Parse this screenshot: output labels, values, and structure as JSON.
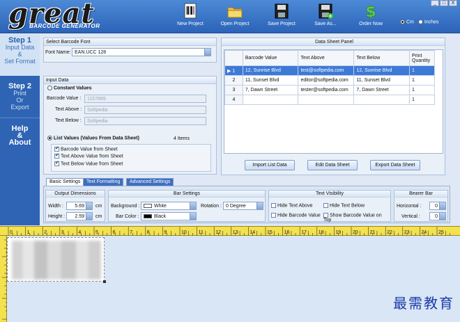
{
  "logo": {
    "title": "great",
    "subtitle": "BARCODE GENERATOR"
  },
  "toolbar": [
    {
      "id": "new",
      "label": "New  Project",
      "icon": "barcode-page-icon"
    },
    {
      "id": "open",
      "label": "Open  Project",
      "icon": "folder-icon"
    },
    {
      "id": "save",
      "label": "Save Project",
      "icon": "floppy-icon"
    },
    {
      "id": "saveas",
      "label": "Save As...",
      "icon": "floppy-add-icon"
    },
    {
      "id": "order",
      "label": "Order Now",
      "icon": "dollar-icon"
    }
  ],
  "window_controls": [
    "_",
    "□",
    "X"
  ],
  "units": {
    "cm": "Cm",
    "inches": "Inches",
    "selected": "cm"
  },
  "steps": [
    {
      "head": "Step 1",
      "lines": [
        "Input Data",
        "&",
        "Set Format"
      ],
      "active": true
    },
    {
      "head": "Step 2",
      "lines": [
        "Print",
        "Or",
        "Export"
      ],
      "active": false
    },
    {
      "head": "Help",
      "lines": [
        "&",
        "About"
      ],
      "active": false
    }
  ],
  "font_panel": {
    "title": "Select Barcode Font",
    "label": "Font Name:",
    "value": "EAN.UCC 128"
  },
  "input_panel": {
    "title": "Input Data",
    "constant_label": "Constant Values",
    "barcode_label": "Barcode Value :",
    "barcode_value": "1157869",
    "above_label": "Text Above :",
    "above_value": "Softpedia",
    "below_label": "Text Below :",
    "below_value": "Softpedia",
    "list_label": "List Values (Values From Data Sheet)",
    "items_count": "4 Items",
    "checks": [
      "Barcode Value from Sheet",
      "Text Above Value from Sheet",
      "Text Below Value from Sheet"
    ]
  },
  "datasheet": {
    "title": "Data Sheet Panel",
    "headers": [
      "Barcode Value",
      "Text Above",
      "Text Below",
      "Print Quantity"
    ],
    "rows": [
      {
        "n": "1",
        "marker": "▶",
        "cells": [
          "12, Sunrise Blvd",
          "test@softpedia.com",
          "12, Sunrise Blvd",
          "1"
        ],
        "selected": true
      },
      {
        "n": "2",
        "marker": "",
        "cells": [
          "11, Sunset Blvd",
          "editor@softpedia.com",
          "11, Sunset Blvd",
          "1"
        ],
        "selected": false
      },
      {
        "n": "3",
        "marker": "",
        "cells": [
          "7, Dawn Street",
          "tester@softpedia.com",
          "7, Dawn Street",
          "1"
        ],
        "selected": false
      },
      {
        "n": "4",
        "marker": "",
        "cells": [
          "",
          "",
          "",
          "1"
        ],
        "selected": false
      }
    ],
    "buttons": [
      "Import List Data",
      "Edit Data Sheet",
      "Export Data Sheet"
    ]
  },
  "tabs": [
    "Basic Settings",
    "Text Formatting",
    "Advanced Settings"
  ],
  "output_dim": {
    "title": "Output Dimensions",
    "width_label": "Width :",
    "width": "5.69",
    "height_label": "Height :",
    "height": "2.59",
    "unit": "cm"
  },
  "bar_settings": {
    "title": "Bar Settings",
    "bg_label": "Background :",
    "bg_value": "White",
    "bg_color": "#ffffff",
    "bar_label": "Bar Color :",
    "bar_value": "Black",
    "bar_color": "#000000",
    "rotation_label": "Rotation :",
    "rotation_value": "0 Degree"
  },
  "text_visibility": {
    "title": "Text Visibility",
    "items": [
      "Hide Text Above",
      "Hide Text Below",
      "Hide Barcode Value",
      "Show Barcode Value on Top"
    ]
  },
  "bearer_bar": {
    "title": "Bearer Bar",
    "h_label": "Horizontal :",
    "h_value": "0",
    "v_label": "Vertical :",
    "v_value": "0"
  },
  "ruler_h": [
    "0",
    "1",
    "2",
    "3",
    "4",
    "5",
    "6",
    "7",
    "8",
    "9",
    "10",
    "11",
    "12",
    "13",
    "14",
    "15",
    "16",
    "17",
    "18",
    "19",
    "20",
    "21",
    "22",
    "23",
    "24",
    "25"
  ],
  "watermark": "最需教育"
}
